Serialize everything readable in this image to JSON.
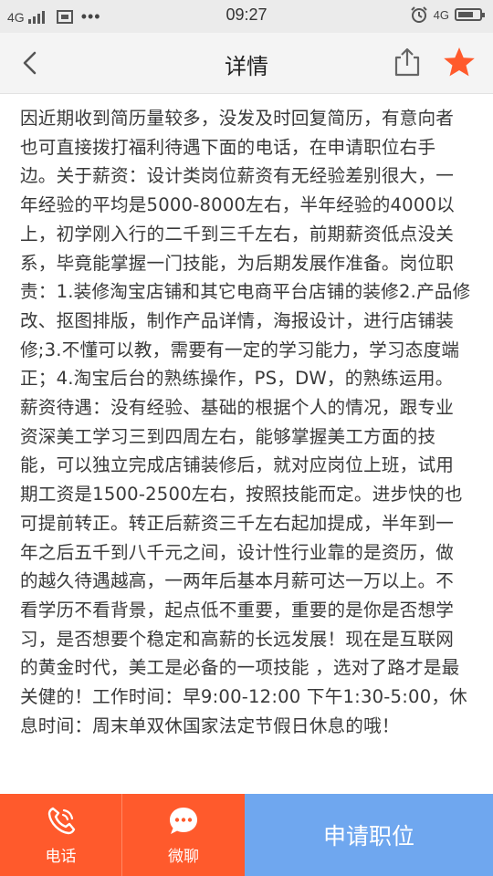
{
  "status_bar": {
    "network_left": "4G",
    "time": "09:27",
    "network_right": "4G"
  },
  "nav": {
    "title": "详情",
    "back_icon": "chevron-left-icon",
    "share_icon": "share-icon",
    "favorite_icon": "star-icon",
    "favorite_color": "#ff5a2c"
  },
  "content": {
    "text": "因近期收到简历量较多，没发及时回复简历，有意向者也可直接拨打福利待遇下面的电话，在申请职位右手边。关于薪资：设计类岗位薪资有无经验差别很大，一年经验的平均是5000-8000左右，半年经验的4000以上，初学刚入行的二千到三千左右，前期薪资低点没关系，毕竟能掌握一门技能，为后期发展作准备。岗位职责：1.装修淘宝店铺和其它电商平台店铺的装修2.产品修改、抠图排版，制作产品详情，海报设计，进行店铺装修;3.不懂可以教，需要有一定的学习能力，学习态度端正；4.淘宝后台的熟练操作，PS，DW，的熟练运用。薪资待遇：没有经验、基础的根据个人的情况，跟专业资深美工学习三到四周左右，能够掌握美工方面的技能，可以独立完成店铺装修后，就对应岗位上班，试用期工资是1500-2500左右，按照技能而定。进步快的也可提前转正。转正后薪资三千左右起加提成，半年到一年之后五千到八千元之间，设计性行业靠的是资历，做的越久待遇越高，一两年后基本月薪可达一万以上。不看学历不看背景，起点低不重要，重要的是你是否想学习，是否想要个稳定和高薪的长远发展！现在是互联网的黄金时代，美工是必备的一项技能 ，选对了路才是最关健的！工作时间：早9:00-12:00 下午1:30-5:00，休息时间：周末单双休国家法定节假日休息的哦！"
  },
  "bottom_bar": {
    "phone_label": "电话",
    "phone_icon": "phone-icon",
    "chat_label": "微聊",
    "chat_icon": "chat-bubble-icon",
    "apply_label": "申请职位",
    "primary_color": "#ff5a2c",
    "apply_color": "#6fa7ef"
  }
}
